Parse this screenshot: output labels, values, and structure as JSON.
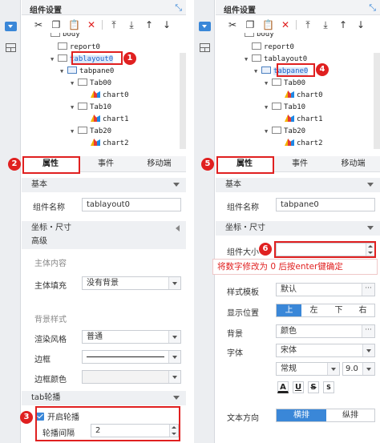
{
  "panel_title": "组件设置",
  "toolbar": {
    "icons": [
      "cut-icon",
      "copy-icon",
      "paste-icon",
      "delete-icon",
      "move-top-icon",
      "move-bottom-icon",
      "move-up-icon",
      "move-down-icon"
    ],
    "glyphs": [
      "✂",
      "❐",
      "📋",
      "✕",
      "⤒",
      "⤓",
      "↑",
      "↓"
    ]
  },
  "tree": {
    "body": "body",
    "report0": "report0",
    "tablayout0": "tablayout0",
    "tabpane0": "tabpane0",
    "tab00": "Tab00",
    "chart0": "chart0",
    "tab10": "Tab10",
    "chart1": "chart1",
    "tab20": "Tab20",
    "chart2": "chart2"
  },
  "tabs": {
    "properties": "属性",
    "events": "事件",
    "mobile": "移动端"
  },
  "left": {
    "basic": "基本",
    "name_label": "组件名称",
    "name_value": "tablayout0",
    "coords": "坐标・尺寸",
    "advanced": "高级",
    "main_content": "主体内容",
    "main_fill_label": "主体填充",
    "main_fill_value": "没有背景",
    "bg_style": "背景样式",
    "render_label": "渲染风格",
    "render_value": "普通",
    "border_label": "边框",
    "border_color_label": "边框颜色",
    "tab_carousel": "tab轮播",
    "enable_carousel": "开启轮播",
    "interval_label": "轮播间隔",
    "interval_value": "2"
  },
  "right": {
    "basic": "基本",
    "name_label": "组件名称",
    "name_value": "tabpane0",
    "coords": "坐标・尺寸",
    "size_label": "组件大小",
    "size_value": "",
    "note": "将数字修改为 0 后按enter键确定",
    "template_label": "样式模板",
    "template_value": "默认",
    "position_label": "显示位置",
    "positions": [
      "上",
      "左",
      "下",
      "右"
    ],
    "background_label": "背景",
    "background_value": "颜色",
    "font_label": "字体",
    "font_value": "宋体",
    "font_style_value": "常规",
    "font_size_value": "9.0",
    "font_buttons": [
      "A",
      "U",
      "S",
      "S"
    ],
    "text_dir_label": "文本方向",
    "text_dir_options": [
      "横排",
      "纵排"
    ]
  },
  "badges": [
    "1",
    "2",
    "3",
    "4",
    "5",
    "6"
  ],
  "colors": {
    "accent": "#3a87d8",
    "highlight": "#e02020"
  }
}
